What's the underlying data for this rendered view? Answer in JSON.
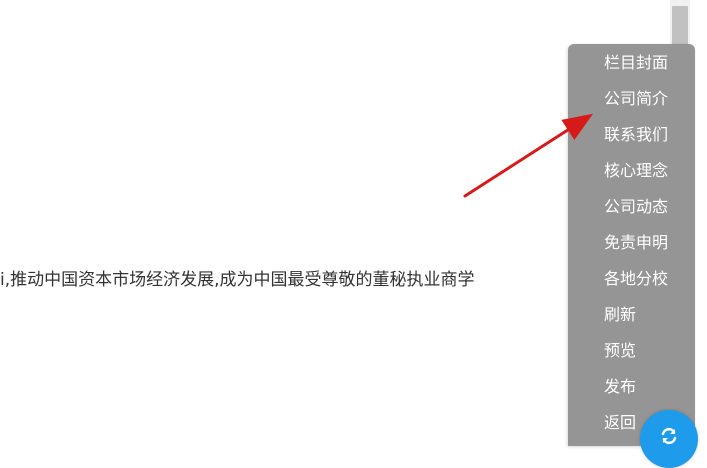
{
  "content": {
    "body_text": "i,推动中国资本市场经济发展,成为中国最受尊敬的董秘执业商学"
  },
  "side_menu": {
    "items": [
      {
        "label": "栏目封面"
      },
      {
        "label": "公司简介"
      },
      {
        "label": "联系我们"
      },
      {
        "label": "核心理念"
      },
      {
        "label": "公司动态"
      },
      {
        "label": "免责申明"
      },
      {
        "label": "各地分校"
      },
      {
        "label": "刷新"
      },
      {
        "label": "预览"
      },
      {
        "label": "发布"
      },
      {
        "label": "返回"
      }
    ]
  },
  "refresh_button": {
    "icon": "refresh-icon"
  },
  "colors": {
    "menu_bg": "#959595",
    "menu_text": "#ffffff",
    "arrow": "#d61a1a",
    "fab_bg": "#1e9bea"
  }
}
